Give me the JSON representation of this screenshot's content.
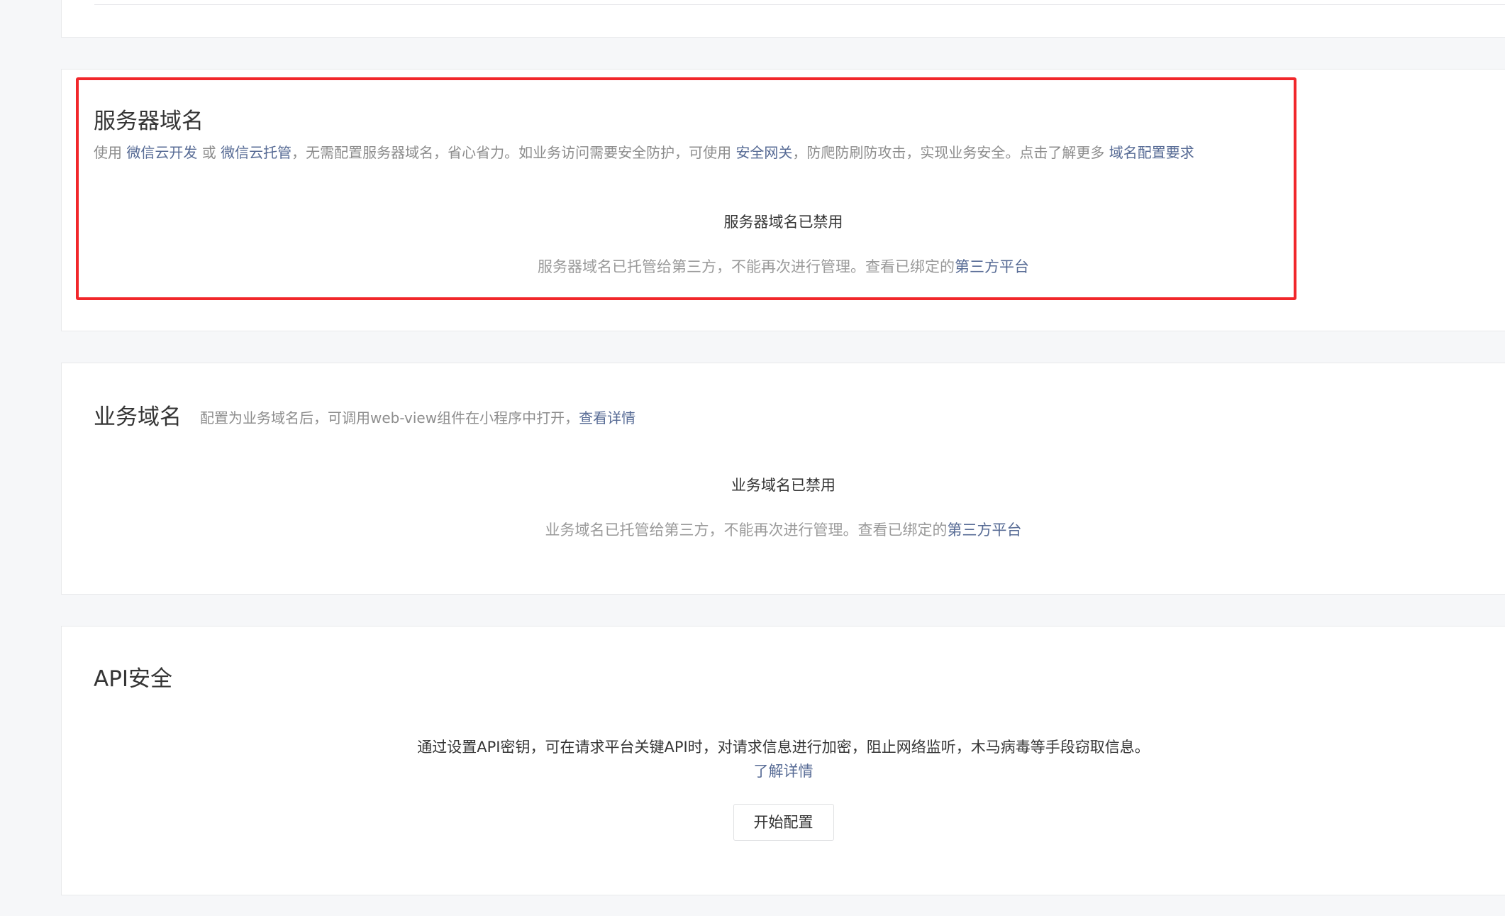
{
  "server_domain": {
    "title": "服务器域名",
    "desc_prefix": "使用",
    "link_cloud_dev": "微信云开发",
    "desc_or": "或",
    "link_cloud_host": "微信云托管",
    "desc_middle": "，无需配置服务器域名，省心省力。如业务访问需要安全防护，可使用",
    "link_gateway": "安全网关",
    "desc_after_gateway": "，防爬防刷防攻击，实现业务安全。点击了解更多",
    "link_requirements": "域名配置要求",
    "status_title": "服务器域名已禁用",
    "status_desc": "服务器域名已托管给第三方，不能再次进行管理。查看已绑定的",
    "status_link": "第三方平台"
  },
  "business_domain": {
    "title": "业务域名",
    "desc": "配置为业务域名后，可调用web-view组件在小程序中打开，",
    "desc_link": "查看详情",
    "status_title": "业务域名已禁用",
    "status_desc": "业务域名已托管给第三方，不能再次进行管理。查看已绑定的",
    "status_link": "第三方平台"
  },
  "api_security": {
    "title": "API安全",
    "desc": "通过设置API密钥，可在请求平台关键API时，对请求信息进行加密，阻止网络监听，木马病毒等手段窃取信息。",
    "learn_more": "了解详情",
    "button_label": "开始配置"
  },
  "colors": {
    "link": "#576b95",
    "highlight_border": "#f1272b",
    "background": "#f6f7f9"
  }
}
